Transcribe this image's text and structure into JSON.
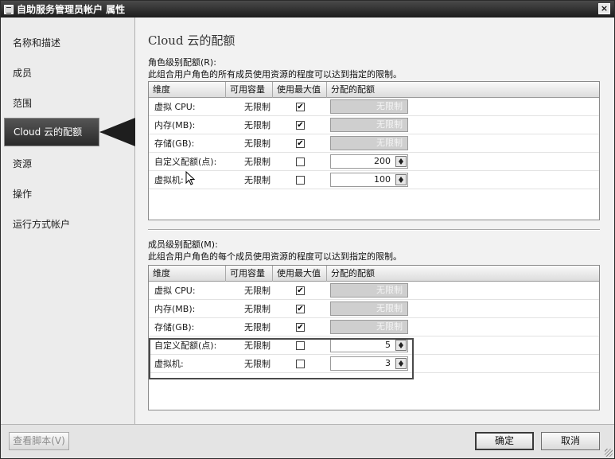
{
  "window": {
    "title": "自助服务管理员帐户 属性",
    "close_glyph": "×"
  },
  "sidebar": {
    "items": [
      {
        "label": "名称和描述"
      },
      {
        "label": "成员"
      },
      {
        "label": "范围"
      },
      {
        "label": "Cloud 云的配额",
        "active": true
      },
      {
        "label": "资源"
      },
      {
        "label": "操作"
      },
      {
        "label": "运行方式帐户"
      }
    ]
  },
  "main": {
    "title": "Cloud 云的配额",
    "role_section": {
      "heading": "角色级别配额(R):",
      "description": "此组合用户角色的所有成员使用资源的程度可以达到指定的限制。",
      "columns": [
        "维度",
        "可用容量",
        "使用最大值",
        "分配的配额"
      ],
      "rows": [
        {
          "dimension": "虚拟 CPU:",
          "capacity": "无限制",
          "use_max": true,
          "quota": "无限制"
        },
        {
          "dimension": "内存(MB):",
          "capacity": "无限制",
          "use_max": true,
          "quota": "无限制"
        },
        {
          "dimension": "存储(GB):",
          "capacity": "无限制",
          "use_max": true,
          "quota": "无限制"
        },
        {
          "dimension": "自定义配额(点):",
          "capacity": "无限制",
          "use_max": false,
          "quota": "200"
        },
        {
          "dimension": "虚拟机:",
          "capacity": "无限制",
          "use_max": false,
          "quota": "100"
        }
      ]
    },
    "member_section": {
      "heading": "成员级别配额(M):",
      "description": "此组合用户角色的每个成员使用资源的程度可以达到指定的限制。",
      "columns": [
        "维度",
        "可用容量",
        "使用最大值",
        "分配的配额"
      ],
      "rows": [
        {
          "dimension": "虚拟 CPU:",
          "capacity": "无限制",
          "use_max": true,
          "quota": "无限制"
        },
        {
          "dimension": "内存(MB):",
          "capacity": "无限制",
          "use_max": true,
          "quota": "无限制"
        },
        {
          "dimension": "存储(GB):",
          "capacity": "无限制",
          "use_max": true,
          "quota": "无限制"
        },
        {
          "dimension": "自定义配额(点):",
          "capacity": "无限制",
          "use_max": false,
          "quota": "5"
        },
        {
          "dimension": "虚拟机:",
          "capacity": "无限制",
          "use_max": false,
          "quota": "3"
        }
      ]
    }
  },
  "footer": {
    "view_script_label": "查看脚本(V)",
    "ok_label": "确定",
    "cancel_label": "取消"
  },
  "checkmark_glyph": "✔"
}
